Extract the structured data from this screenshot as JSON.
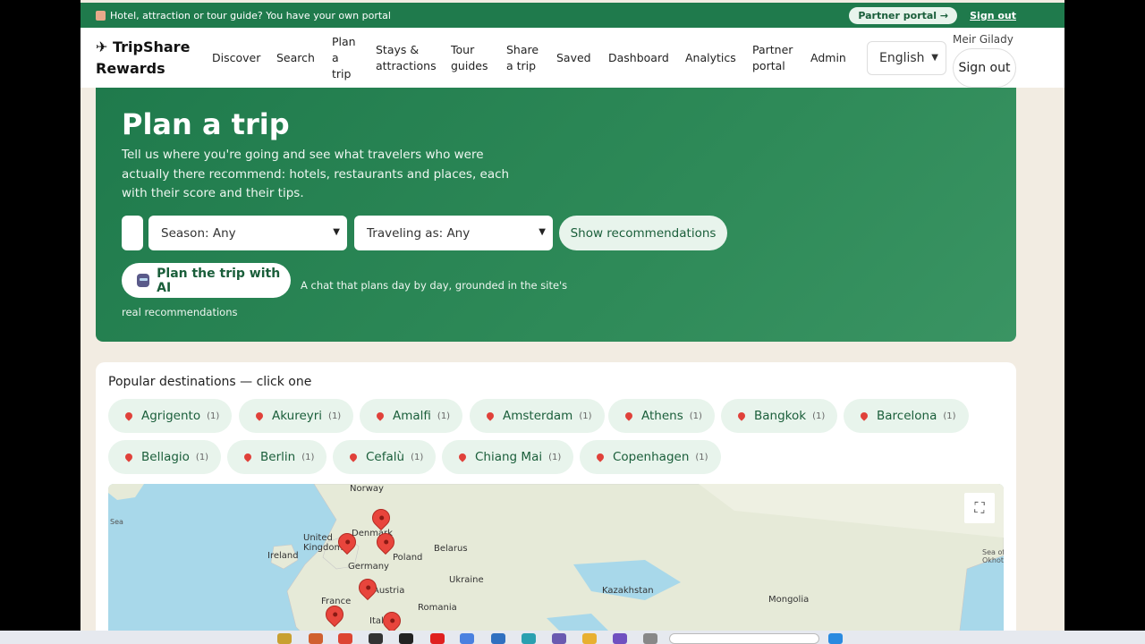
{
  "topbar": {
    "message": "Hotel, attraction or tour guide? You have your own portal",
    "partner_pill": "Partner portal →",
    "signout": "Sign out"
  },
  "brand": {
    "name": "✈ TripShare Rewards"
  },
  "nav": {
    "items": [
      "Discover",
      "Search",
      "Plan a trip",
      "Stays & attractions",
      "Tour guides",
      "Share a trip",
      "Saved",
      "Dashboard",
      "Analytics",
      "Partner portal",
      "Admin"
    ],
    "language": "English",
    "user": "Meir Gilady",
    "signout": "Sign out"
  },
  "hero": {
    "title": "Plan a trip",
    "description": "Tell us where you're going and see what travelers who were actually there recommend: hotels, restaurants and places, each with their score and their tips.",
    "season_select": "Season: Any",
    "traveling_select": "Traveling as: Any",
    "show_button": "Show recommendations",
    "ai_button": "Plan the trip with AI",
    "ai_note": "A chat that plans day by day, grounded in the site's real recommendations"
  },
  "destinations": {
    "title": "Popular destinations — click one",
    "items": [
      {
        "name": "Agrigento",
        "count": "(1)"
      },
      {
        "name": "Akureyri",
        "count": "(1)"
      },
      {
        "name": "Amalfi",
        "count": "(1)"
      },
      {
        "name": "Amsterdam",
        "count": "(1)"
      },
      {
        "name": "Athens",
        "count": "(1)"
      },
      {
        "name": "Bangkok",
        "count": "(1)"
      },
      {
        "name": "Barcelona",
        "count": "(1)"
      },
      {
        "name": "Bellagio",
        "count": "(1)"
      },
      {
        "name": "Berlin",
        "count": "(1)"
      },
      {
        "name": "Cefalù",
        "count": "(1)"
      },
      {
        "name": "Chiang Mai",
        "count": "(1)"
      },
      {
        "name": "Copenhagen",
        "count": "(1)"
      }
    ]
  },
  "map": {
    "labels": [
      "Norway",
      "Denmark",
      "United Kingdom",
      "Ireland",
      "Belarus",
      "Poland",
      "Germany",
      "Ukraine",
      "Austria",
      "France",
      "Romania",
      "Italy",
      "Kazakhstan",
      "Mongolia",
      "Sea",
      "Sea of Okhotsk"
    ],
    "fullscreen_glyph": "⛶"
  },
  "colors": {
    "brand_green": "#1f7a4c",
    "chip_bg": "#e8f4ec",
    "pin_red": "#e8453c"
  }
}
